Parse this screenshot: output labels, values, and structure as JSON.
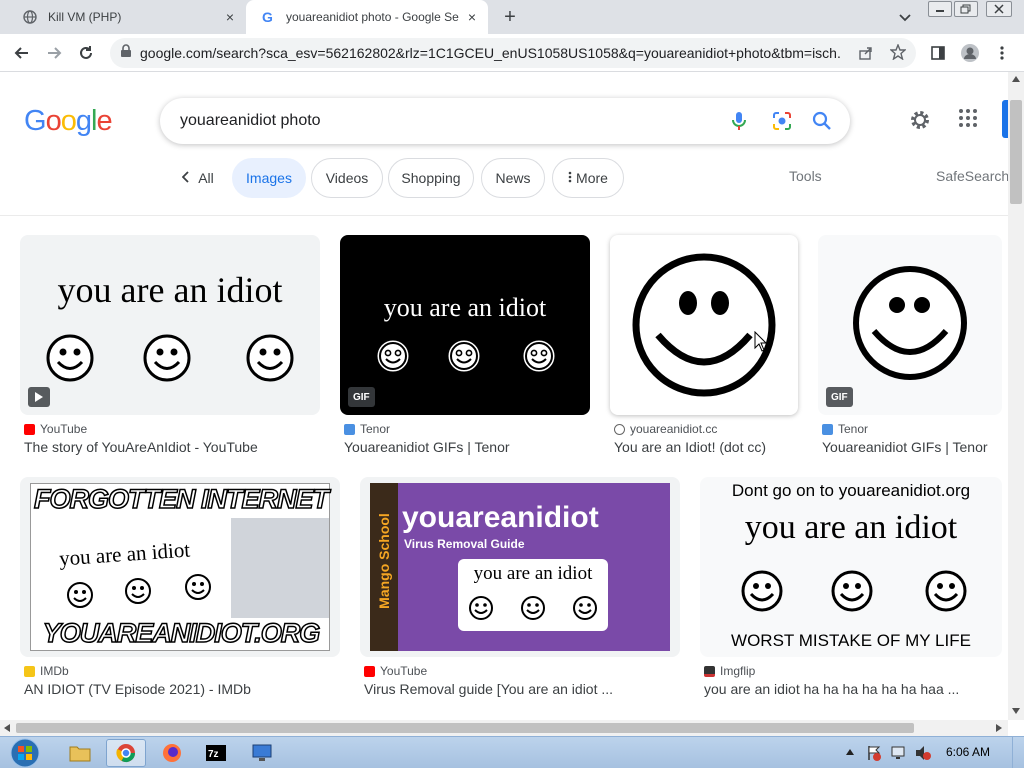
{
  "tabs": [
    {
      "title": "Kill VM (PHP)",
      "close": "×"
    },
    {
      "title": "youareanidiot photo - Google Se",
      "close": "×"
    }
  ],
  "newtab": "+",
  "window_buttons": {
    "minimize": "▭",
    "restore": "⧉",
    "close": "×"
  },
  "address": {
    "url": "google.com/search?sca_esv=562162802&rlz=1C1GCEU_enUS1058US1058&q=youareanidiot+photo&tbm=isch..."
  },
  "google": {
    "logo": [
      "G",
      "o",
      "o",
      "g",
      "l",
      "e"
    ],
    "logo_colors": [
      "#4285f4",
      "#ea4335",
      "#fbbc05",
      "#4285f4",
      "#34a853",
      "#ea4335"
    ],
    "query": "youareanidiot photo"
  },
  "chips": {
    "all": "All",
    "images": "Images",
    "videos": "Videos",
    "shopping": "Shopping",
    "news": "News",
    "more": "More",
    "tools": "Tools",
    "safesearch": "SafeSearch"
  },
  "results": [
    {
      "source": "YouTube",
      "title": "The story of YouAreAnIdiot - YouTube",
      "caption": "you are an idiot",
      "fav_color": "#ff0000"
    },
    {
      "source": "Tenor",
      "title": "Youareanidiot GIFs | Tenor",
      "caption": "you are an idiot",
      "badge": "GIF",
      "fav_color": "#4a90e2"
    },
    {
      "source": "youareanidiot.cc",
      "title": "You are an Idiot! (dot cc)",
      "fav_color": "#666666"
    },
    {
      "source": "Tenor",
      "title": "Youareanidiot GIFs | Tenor",
      "badge": "GIF",
      "fav_color": "#4a90e2"
    },
    {
      "source": "IMDb",
      "title": "AN IDIOT (TV Episode 2021) - IMDb",
      "caption_top": "FORGOTTEN INTERNET",
      "caption": "you are an idiot",
      "caption_bottom": "YOUAREANIDIOT.ORG",
      "fav_color": "#f5c518"
    },
    {
      "source": "YouTube",
      "title": "Virus Removal guide [You are an idiot ...",
      "caption_main": "youareanidiot",
      "caption_sub": "Virus Removal Guide",
      "caption": "you are an idiot",
      "side_label": "Mango School",
      "fav_color": "#ff0000"
    },
    {
      "source": "Imgflip",
      "title": "you are an idiot ha ha ha ha ha ha haa ...",
      "caption_top": "Dont go on to youareanidiot.org",
      "caption": "you are an idiot",
      "caption_bottom": "WORST MISTAKE OF MY LIFE",
      "fav_color": "#333333"
    }
  ],
  "taskbar": {
    "clock": "6:06 AM"
  }
}
